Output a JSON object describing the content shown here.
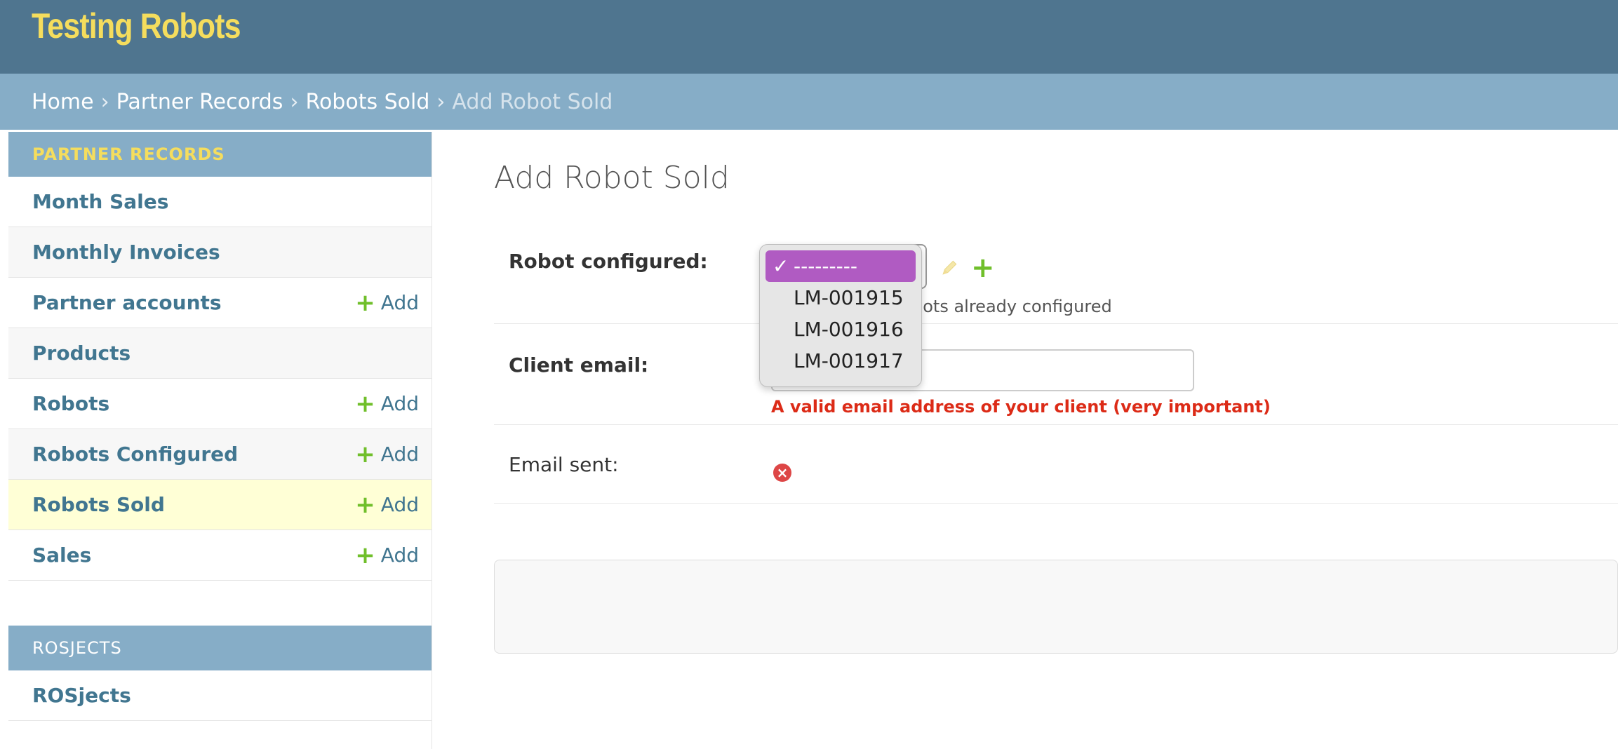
{
  "app": {
    "title": "Testing Robots"
  },
  "breadcrumb": {
    "items": [
      "Home",
      "Partner Records",
      "Robots Sold"
    ],
    "current": "Add Robot Sold",
    "separator": "›"
  },
  "sidebar": {
    "partner_records": {
      "caption": "PARTNER RECORDS",
      "items": [
        {
          "label": "Month Sales",
          "add": ""
        },
        {
          "label": "Monthly Invoices",
          "add": ""
        },
        {
          "label": "Partner accounts",
          "add": "Add"
        },
        {
          "label": "Products",
          "add": ""
        },
        {
          "label": "Robots",
          "add": "Add"
        },
        {
          "label": "Robots Configured",
          "add": "Add"
        },
        {
          "label": "Robots Sold",
          "add": "Add"
        },
        {
          "label": "Sales",
          "add": "Add"
        }
      ]
    },
    "rosjects": {
      "caption": "ROSJECTS",
      "items": [
        {
          "label": "ROSjects"
        }
      ]
    }
  },
  "main": {
    "title": "Add Robot Sold",
    "robot_configured": {
      "label": "Robot configured:",
      "help": "bots already configured",
      "options": [
        "---------",
        "LM-001915",
        "LM-001916",
        "LM-001917"
      ],
      "selected_index": 0,
      "check_glyph": "✓"
    },
    "client_email": {
      "label": "Client email:",
      "value": "",
      "help_error": "A valid email address of your client (very important)"
    },
    "email_sent": {
      "label": "Email sent:",
      "glyph": "×"
    }
  },
  "colors": {
    "header": "#4f758f",
    "breadcrumb": "#86adc7",
    "brand": "#f5dd5d",
    "link": "#417690",
    "add_green": "#70bf2b",
    "error_red": "#dc2b17",
    "selected_option": "#b05bc2"
  }
}
